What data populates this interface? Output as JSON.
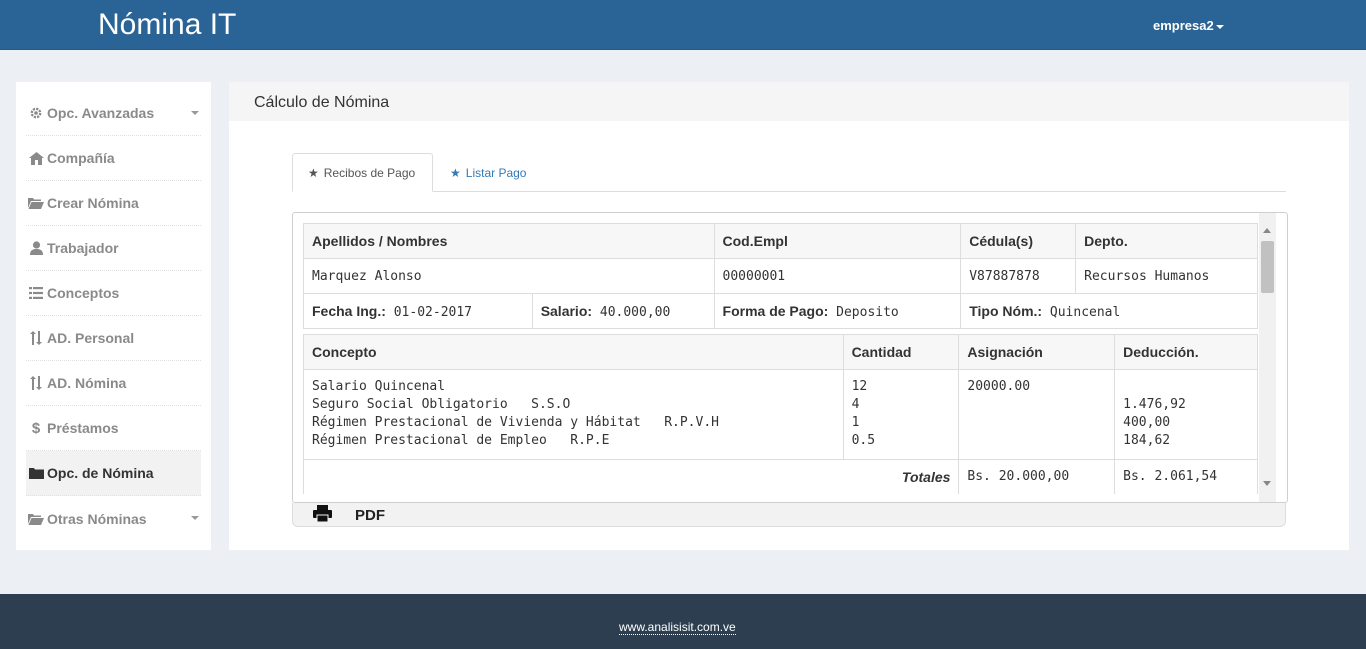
{
  "navbar": {
    "brand": "Nómina IT",
    "user": "empresa2"
  },
  "sidebar": {
    "items": [
      {
        "label": "Opc. Avanzadas"
      },
      {
        "label": "Compañía"
      },
      {
        "label": "Crear Nómina"
      },
      {
        "label": "Trabajador"
      },
      {
        "label": "Conceptos"
      },
      {
        "label": "AD. Personal"
      },
      {
        "label": "AD. Nómina"
      },
      {
        "label": "Préstamos"
      },
      {
        "label": "Opc. de Nómina"
      },
      {
        "label": "Otras Nóminas"
      }
    ]
  },
  "panel": {
    "title": "Cálculo de Nómina",
    "tabs": [
      {
        "label": "Recibos de Pago"
      },
      {
        "label": "Listar Pago"
      }
    ]
  },
  "employee": {
    "headers": {
      "name": "Apellidos / Nombres",
      "code": "Cod.Empl",
      "id": "Cédula(s)",
      "dept": "Depto."
    },
    "name": "Marquez Alonso",
    "code": "00000001",
    "id": "V87887878",
    "dept": "Recursos Humanos",
    "fecha_label": "Fecha Ing.:",
    "fecha": "01-02-2017",
    "salario_label": "Salario:",
    "salario": "40.000,00",
    "forma_label": "Forma de Pago:",
    "forma": "Deposito",
    "tipo_label": "Tipo Nóm.:",
    "tipo": "Quincenal"
  },
  "concepts": {
    "headers": {
      "concepto": "Concepto",
      "cantidad": "Cantidad",
      "asignacion": "Asignación",
      "deduccion": "Deducción."
    },
    "rows": [
      {
        "concepto": "Salario Quincenal",
        "cantidad": "12",
        "asignacion": "20000.00",
        "deduccion": ""
      },
      {
        "concepto": "Seguro Social Obligatorio   S.S.O",
        "cantidad": "4",
        "asignacion": "",
        "deduccion": "1.476,92"
      },
      {
        "concepto": "Régimen Prestacional de Vivienda y Hábitat   R.P.V.H",
        "cantidad": "1",
        "asignacion": "",
        "deduccion": "400,00"
      },
      {
        "concepto": "Régimen Prestacional de Empleo   R.P.E",
        "cantidad": "0.5",
        "asignacion": "",
        "deduccion": "184,62"
      }
    ],
    "totales_label": "Totales",
    "total_asignacion": "Bs. 20.000,00",
    "total_deduccion": "Bs. 2.061,54"
  },
  "toolbar": {
    "pdf_label": "PDF"
  },
  "footer": {
    "link": "www.analisisit.com.ve"
  },
  "icons": [
    "gear-icon",
    "home-icon",
    "folder-open-icon",
    "user-icon",
    "list-icon",
    "sort-icon",
    "dollar-icon",
    "folder-icon",
    "star-icon",
    "print-icon",
    "caret-down-icon"
  ],
  "colors": {
    "navbar": "#2a6496",
    "footer": "#2c3e50",
    "link": "#337ab7"
  }
}
